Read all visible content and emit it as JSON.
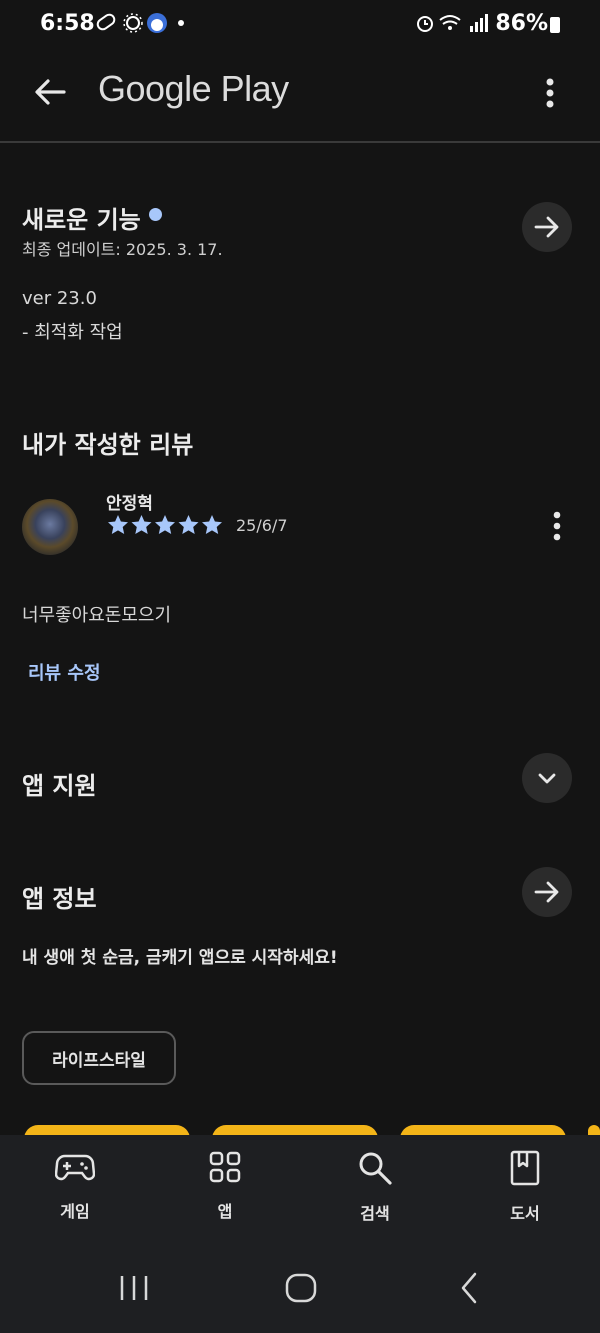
{
  "status": {
    "time": "6:58",
    "battery": "86%"
  },
  "appbar": {
    "title": "Google Play"
  },
  "whats_new": {
    "title": "새로운 기능",
    "updated": "최종 업데이트: 2025. 3. 17.",
    "version": "ver 23.0",
    "note": "- 최적화 작업"
  },
  "my_review": {
    "title": "내가 작성한 리뷰",
    "author": "안정혁",
    "rating": 5,
    "date": "25/6/7",
    "text": "너무좋아요돈모으기",
    "edit_label": "리뷰 수정"
  },
  "app_support": {
    "title": "앱 지원"
  },
  "app_info": {
    "title": "앱 정보",
    "description": "내 생애 첫 순금, 금캐기 앱으로 시작하세요!",
    "category_chip": "라이프스타일"
  },
  "bottom_nav": [
    {
      "label": "게임",
      "icon": "gamepad-icon"
    },
    {
      "label": "앱",
      "icon": "apps-grid-icon"
    },
    {
      "label": "검색",
      "icon": "search-icon"
    },
    {
      "label": "도서",
      "icon": "book-icon"
    }
  ],
  "colors": {
    "accent": "#a8c7fa",
    "card": "#f3b418",
    "background": "#141414"
  }
}
